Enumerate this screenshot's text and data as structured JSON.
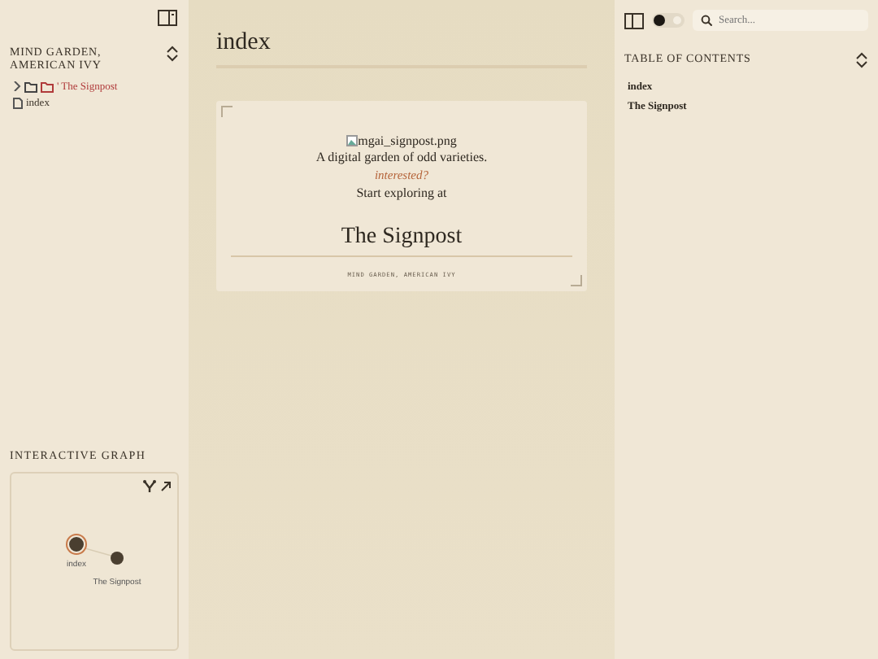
{
  "explorer": {
    "title": "MIND GARDEN, AMERICAN IVY",
    "items": [
      {
        "kind": "folder",
        "label": "' The Signpost",
        "expanded": false
      },
      {
        "kind": "file",
        "label": "index"
      }
    ]
  },
  "graph": {
    "title": "INTERACTIVE GRAPH",
    "nodes": [
      {
        "label": "index",
        "current": true
      },
      {
        "label": "The Signpost",
        "current": false
      }
    ]
  },
  "page": {
    "title": "index",
    "image_alt": "mgai_signpost.png",
    "tagline": "A digital garden of odd varieties.",
    "link": "interested?",
    "prompt": "Start exploring at",
    "heading": "The Signpost",
    "footer": "MIND GARDEN, AMERICAN IVY"
  },
  "toolbar": {
    "dark_mode": false,
    "search": {
      "placeholder": "Search..."
    }
  },
  "toc": {
    "title": "TABLE OF CONTENTS",
    "items": [
      {
        "label": "index"
      },
      {
        "label": "The Signpost"
      }
    ]
  }
}
